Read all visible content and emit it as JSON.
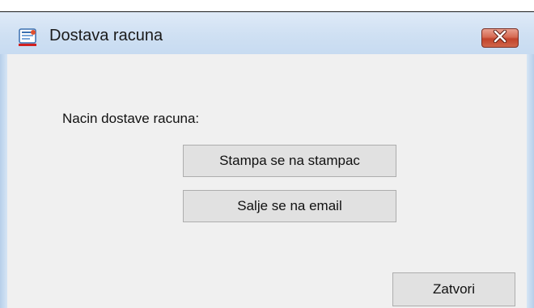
{
  "window": {
    "title": "Dostava racuna"
  },
  "dialog": {
    "prompt": "Nacin dostave racuna:",
    "print_button": "Stampa se na stampac",
    "email_button": "Salje se na email",
    "close_button": "Zatvori"
  },
  "icons": {
    "app": "invoice-app-icon",
    "close": "close-icon"
  },
  "colors": {
    "close_button_red": "#c2432b",
    "titlebar_blue": "#cfe0f3",
    "client_gray": "#f0f0f0"
  }
}
